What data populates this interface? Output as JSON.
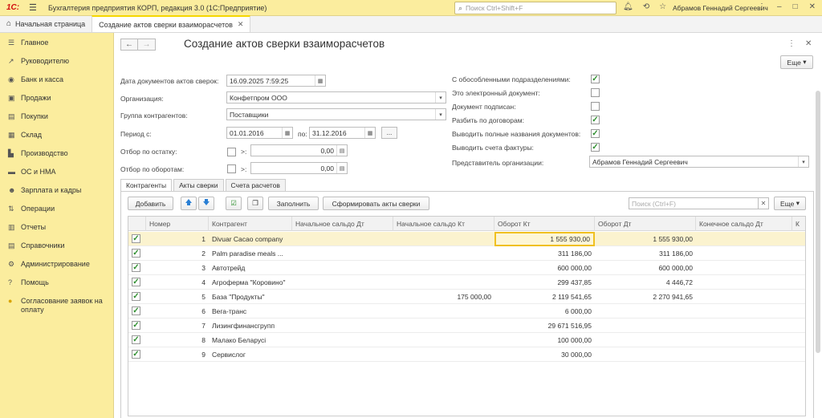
{
  "app": {
    "logo": "1С:",
    "title": "Бухгалтерия предприятия КОРП, редакция 3.0  (1С:Предприятие)",
    "search_placeholder": "Поиск Ctrl+Shift+F",
    "user": "Абрамов Геннадий Сергеевич"
  },
  "tabs": {
    "home": "Начальная страница",
    "doc": "Создание актов сверки взаиморасчетов"
  },
  "sidebar": {
    "items": [
      {
        "label": "Главное",
        "icon": "hamburger-icon"
      },
      {
        "label": "Руководителю",
        "icon": "chart-icon"
      },
      {
        "label": "Банк и касса",
        "icon": "coins-icon"
      },
      {
        "label": "Продажи",
        "icon": "bag-icon"
      },
      {
        "label": "Покупки",
        "icon": "basket-icon"
      },
      {
        "label": "Склад",
        "icon": "warehouse-icon"
      },
      {
        "label": "Производство",
        "icon": "factory-icon"
      },
      {
        "label": "ОС и НМА",
        "icon": "truck-icon"
      },
      {
        "label": "Зарплата и кадры",
        "icon": "people-icon"
      },
      {
        "label": "Операции",
        "icon": "operations-icon"
      },
      {
        "label": "Отчеты",
        "icon": "report-icon"
      },
      {
        "label": "Справочники",
        "icon": "book-icon"
      },
      {
        "label": "Администрирование",
        "icon": "gear-icon"
      },
      {
        "label": "Помощь",
        "icon": "help-icon"
      },
      {
        "label": "Согласование заявок на оплату",
        "icon": "coin-icon"
      }
    ]
  },
  "form": {
    "title": "Создание актов сверки взаиморасчетов",
    "more_label": "Еще",
    "date_label": "Дата документов актов сверок:",
    "date_value": "16.09.2025  7:59:25",
    "org_label": "Организация:",
    "org_value": "Конфетпром ООО",
    "group_label": "Группа контрагентов:",
    "group_value": "Поставщики",
    "period_label": "Период с:",
    "period_from": "01.01.2016",
    "period_to_label": "по:",
    "period_to": "31.12.2016",
    "period_btn": "...",
    "balance_filter_label": "Отбор по остатку:",
    "turnover_filter_label": "Отбор по оборотам:",
    "gt": ">:",
    "balance_value": "0,00",
    "turnover_value": "0,00",
    "right_options": [
      {
        "label": "С обособленными подразделениями:",
        "checked": true
      },
      {
        "label": "Это электронный документ:",
        "checked": false
      },
      {
        "label": "Документ подписан:",
        "checked": false
      },
      {
        "label": "Разбить по договорам:",
        "checked": true
      },
      {
        "label": "Выводить полные названия документов:",
        "checked": true
      },
      {
        "label": "Выводить счета фактуры:",
        "checked": true
      }
    ],
    "rep_label": "Представитель организации:",
    "rep_value": "Абрамов Геннадий Сергеевич"
  },
  "form_tabs": [
    "Контрагенты",
    "Акты сверки",
    "Счета расчетов"
  ],
  "toolbar": {
    "add": "Добавить",
    "fill": "Заполнить",
    "generate": "Сформировать акты сверки",
    "search_placeholder": "Поиск (Ctrl+F)",
    "more": "Еще"
  },
  "table": {
    "columns": [
      "Номер",
      "Контрагент",
      "Начальное сальдо Дт",
      "Начальное сальдо Кт",
      "Оборот Кт",
      "Оборот Дт",
      "Конечное сальдо Дт",
      "К"
    ],
    "rows": [
      {
        "n": "1",
        "name": "Divuar Cacao company",
        "sdt": "",
        "skt": "",
        "okt": "1 555 930,00",
        "odt": "1 555 930,00"
      },
      {
        "n": "2",
        "name": "Palm paradise meals ...",
        "sdt": "",
        "skt": "",
        "okt": "311 186,00",
        "odt": "311 186,00"
      },
      {
        "n": "3",
        "name": "Автотрейд",
        "sdt": "",
        "skt": "",
        "okt": "600 000,00",
        "odt": "600 000,00"
      },
      {
        "n": "4",
        "name": "Агроферма \"Коровино\"",
        "sdt": "",
        "skt": "",
        "okt": "299 437,85",
        "odt": "4 446,72"
      },
      {
        "n": "5",
        "name": "База \"Продукты\"",
        "sdt": "",
        "skt": "175 000,00",
        "okt": "2 119 541,65",
        "odt": "2 270 941,65"
      },
      {
        "n": "6",
        "name": "Вега-транс",
        "sdt": "",
        "skt": "",
        "okt": "6 000,00",
        "odt": ""
      },
      {
        "n": "7",
        "name": "Лизингфинансгрупп",
        "sdt": "",
        "skt": "",
        "okt": "29 671 516,95",
        "odt": ""
      },
      {
        "n": "8",
        "name": "Малако Беларусі",
        "sdt": "",
        "skt": "",
        "okt": "100 000,00",
        "odt": ""
      },
      {
        "n": "9",
        "name": "Сервислог",
        "sdt": "",
        "skt": "",
        "okt": "30 000,00",
        "odt": ""
      }
    ]
  }
}
